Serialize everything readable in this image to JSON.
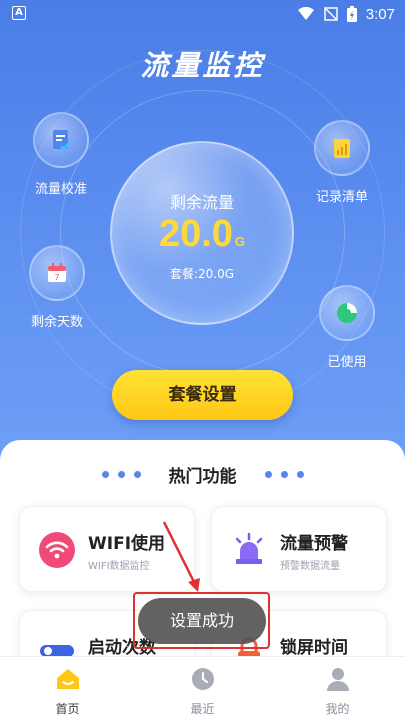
{
  "status_bar": {
    "app_badge": "A",
    "time": "3:07"
  },
  "app": {
    "title": "流量监控"
  },
  "side_buttons": {
    "calibrate": "流量校准",
    "records": "记录清单",
    "days_left": "剩余天数",
    "used": "已使用"
  },
  "bubble": {
    "label": "剩余流量",
    "value": "20.0",
    "unit": "G",
    "plan": "套餐:20.0G"
  },
  "plan_button": "套餐设置",
  "features": {
    "title": "热门功能",
    "cards": [
      {
        "title": "WIFI使用",
        "subtitle": "WIFI数据监控"
      },
      {
        "title": "流量预警",
        "subtitle": "预警数据流量"
      },
      {
        "title": "启动次数",
        "subtitle": ""
      },
      {
        "title": "锁屏时间",
        "subtitle": ""
      }
    ]
  },
  "toast": "设置成功",
  "nav": [
    {
      "label": "首页",
      "icon": "home-icon",
      "active": true
    },
    {
      "label": "最近",
      "icon": "clock-icon",
      "active": false
    },
    {
      "label": "我的",
      "icon": "user-icon",
      "active": false
    }
  ],
  "colors": {
    "hero_blue": "#4a7de6",
    "accent_yellow": "#ffd83a",
    "wifi_pink": "#f24a78",
    "alert_purple": "#7a5cf0",
    "annotation_red": "#e23030"
  }
}
